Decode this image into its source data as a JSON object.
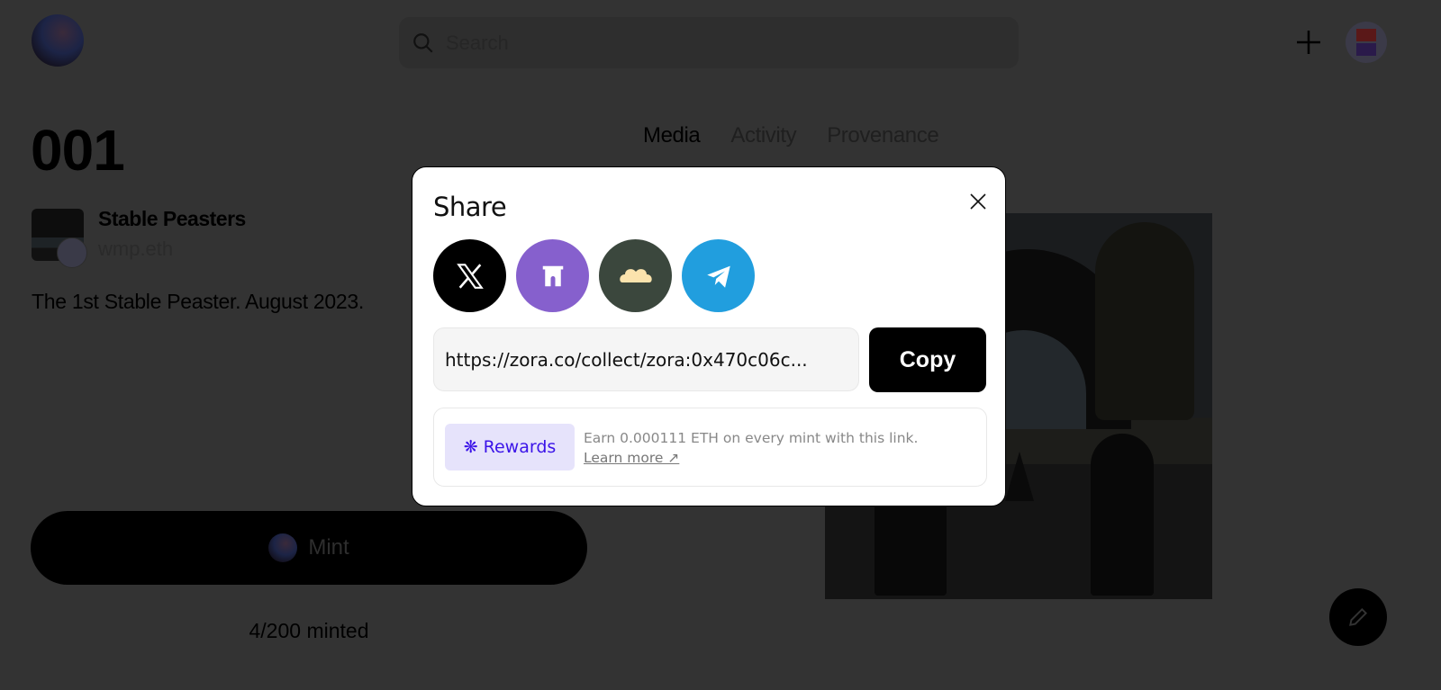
{
  "header": {
    "search_placeholder": "Search"
  },
  "token": {
    "title": "001",
    "collection_name": "Stable Peasters",
    "owner": "wmp.eth",
    "description": "The 1st Stable Peaster. August 2023."
  },
  "tabs": [
    {
      "label": "Media",
      "active": true
    },
    {
      "label": "Activity"
    },
    {
      "label": "Provenance"
    }
  ],
  "mint": {
    "label": "Mint",
    "minted": "4/200 minted"
  },
  "modal": {
    "title": "Share",
    "socials": [
      {
        "name": "X",
        "icon": "x-logo-icon",
        "color": "#000000"
      },
      {
        "name": "Farcaster",
        "icon": "farcaster-icon",
        "color": "#8660cd"
      },
      {
        "name": "Lens",
        "icon": "lens-icon",
        "color": "#3b473d"
      },
      {
        "name": "Telegram",
        "icon": "telegram-icon",
        "color": "#219ede"
      }
    ],
    "url": "https://zora.co/collect/zora:0x470c06c...",
    "copy_label": "Copy",
    "rewards_label": "Rewards",
    "rewards_text": "Earn 0.000111 ETH on every mint with this link.",
    "learn_more": "Learn more ↗"
  }
}
